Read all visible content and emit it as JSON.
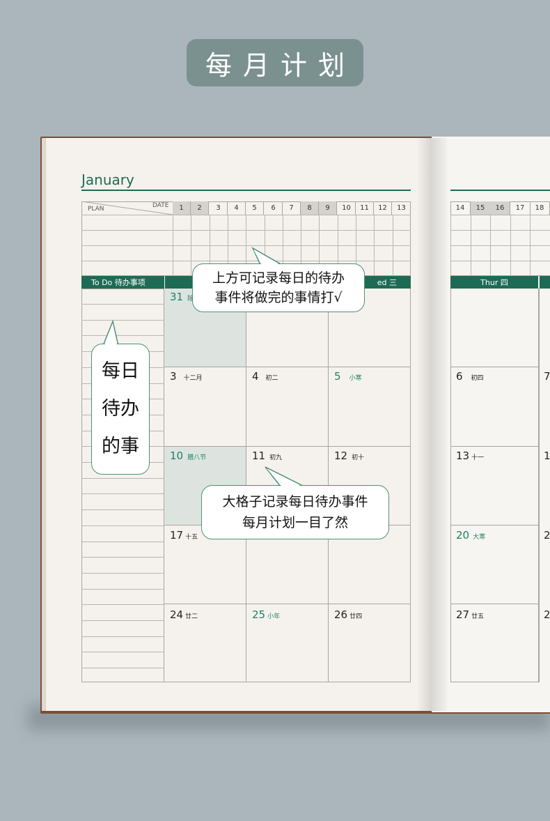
{
  "header": {
    "title": "每月计划"
  },
  "planner": {
    "month": "January",
    "plan_label": "PLAN",
    "date_label": "DATE",
    "dates_left": [
      "1",
      "2",
      "3",
      "4",
      "5",
      "6",
      "7",
      "8",
      "9",
      "10",
      "11",
      "12",
      "13"
    ],
    "dates_right": [
      "14",
      "15",
      "16",
      "17",
      "18"
    ],
    "todo_header": "To Do  待办事项",
    "wed_header": "ed 三",
    "thur_header": "Thur 四",
    "days": {
      "d31": "31",
      "d31_l": "除",
      "d3": "3",
      "d3_l": "十二月",
      "d4": "4",
      "d4_l": "初二",
      "d5": "5",
      "d5_l": "小寒",
      "d6": "6",
      "d6_l": "初四",
      "d7": "7",
      "d10": "10",
      "d10_l": "腊八节",
      "d11": "11",
      "d11_l": "初九",
      "d12": "12",
      "d12_l": "初十",
      "d13": "13",
      "d13_l": "十一",
      "d14": "1",
      "d17": "17",
      "d17_l": "十五",
      "d20": "20",
      "d20_l": "大寒",
      "d21": "2",
      "d24": "24",
      "d24_l": "廿二",
      "d25": "25",
      "d25_l": "小年",
      "d26": "26",
      "d26_l": "廿四",
      "d27": "27",
      "d27_l": "廿五",
      "d28": "2"
    }
  },
  "callouts": {
    "top": {
      "line1": "上方可记录每日的待办",
      "line2": "事件将做完的事情打√"
    },
    "left": {
      "line1": "每日",
      "line2": "待办",
      "line3": "的事"
    },
    "bottom": {
      "line1": "大格子记录每日待办事件",
      "line2": "每月计划一目了然"
    }
  },
  "colors": {
    "accent": "#1e6b55",
    "background": "#aab6bc",
    "badge": "#7b9190"
  }
}
